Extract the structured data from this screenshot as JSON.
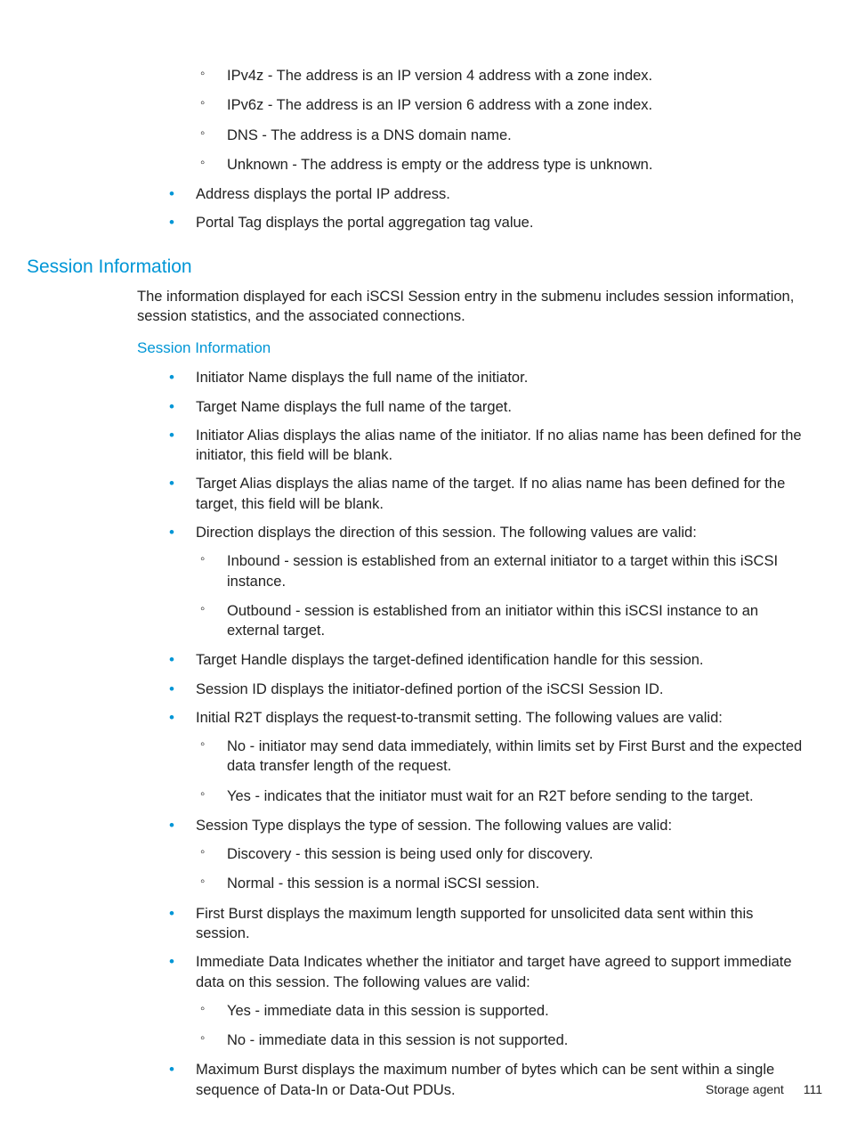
{
  "top_continuation_sub": [
    "IPv4z - The address is an IP version 4 address with a zone index.",
    "IPv6z - The address is an IP version 6 address with a zone index.",
    "DNS - The address is a DNS domain name.",
    "Unknown - The address is empty or the address type is unknown."
  ],
  "top_continuation_outer": [
    "Address displays the portal IP address.",
    "Portal Tag displays the portal aggregation tag value."
  ],
  "heading_session_info": "Session Information",
  "session_intro": "The information displayed for each iSCSI Session entry in the submenu includes session information, session statistics, and the associated connections.",
  "subheading_session_info": "Session Information",
  "session_items": [
    {
      "text": "Initiator Name displays the full name of the initiator."
    },
    {
      "text": "Target Name displays the full name of the target."
    },
    {
      "text": "Initiator Alias displays the alias name of the initiator. If no alias name has been defined for the initiator, this field will be blank."
    },
    {
      "text": "Target Alias displays the alias name of the target. If no alias name has been defined for the target, this field will be blank."
    },
    {
      "text": "Direction displays the direction of this session. The following values are valid:",
      "sub": [
        "Inbound - session is established from an external initiator to a target within this iSCSI instance.",
        "Outbound - session is established from an initiator within this iSCSI instance to an external target."
      ]
    },
    {
      "text": "Target Handle displays the target-defined identification handle for this session."
    },
    {
      "text": "Session ID displays the initiator-defined portion of the iSCSI Session ID."
    },
    {
      "text": "Initial R2T displays the request-to-transmit setting. The following values are valid:",
      "sub": [
        "No - initiator may send data immediately, within limits set by First Burst and the expected data transfer length of the request.",
        "Yes - indicates that the initiator must wait for an R2T before sending to the target."
      ]
    },
    {
      "text": "Session Type displays the type of session. The following values are valid:",
      "sub": [
        "Discovery - this session is being used only for discovery.",
        "Normal - this session is a normal iSCSI session."
      ]
    },
    {
      "text": "First Burst displays the maximum length supported for unsolicited data sent within this session."
    },
    {
      "text": "Immediate Data Indicates whether the initiator and target have agreed to support immediate data on this session. The following values are valid:",
      "sub": [
        "Yes - immediate data in this session is supported.",
        "No - immediate data in this session is not supported."
      ]
    },
    {
      "text": "Maximum Burst displays the maximum number of bytes which can be sent within a single sequence of Data-In or Data-Out PDUs."
    }
  ],
  "footer_label": "Storage agent",
  "footer_page": "111"
}
